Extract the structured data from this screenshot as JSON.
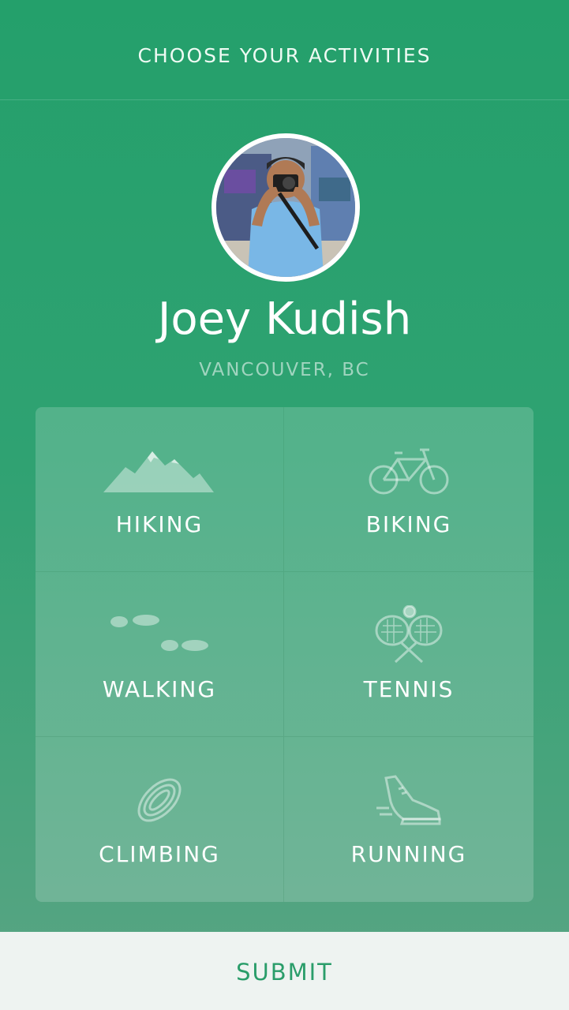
{
  "header": {
    "title": "CHOOSE YOUR ACTIVITIES"
  },
  "profile": {
    "name": "Joey Kudish",
    "location": "VANCOUVER, BC"
  },
  "activities": [
    {
      "label": "HIKING",
      "icon": "mountain-icon"
    },
    {
      "label": "BIKING",
      "icon": "bicycle-icon"
    },
    {
      "label": "WALKING",
      "icon": "footprints-icon"
    },
    {
      "label": "TENNIS",
      "icon": "tennis-rackets-icon"
    },
    {
      "label": "CLIMBING",
      "icon": "rope-icon"
    },
    {
      "label": "RUNNING",
      "icon": "running-shoe-icon"
    }
  ],
  "submit": {
    "label": "SUBMIT"
  },
  "colors": {
    "accent": "#24a06b",
    "submit_text": "#2a9d6a"
  }
}
